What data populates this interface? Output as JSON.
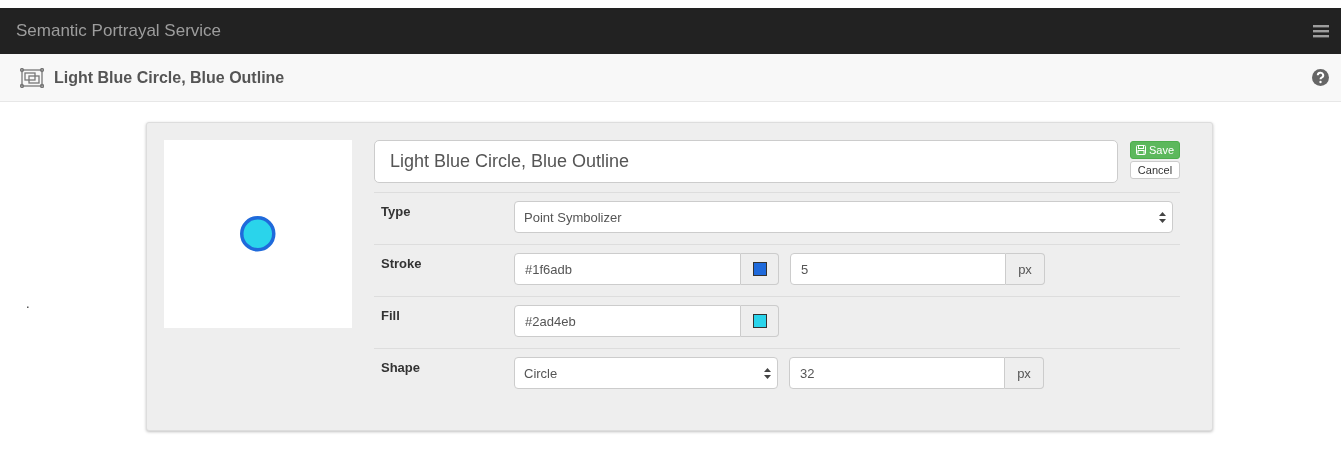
{
  "navbar": {
    "title": "Semantic Portrayal Service"
  },
  "header": {
    "title": "Light Blue Circle, Blue Outline"
  },
  "stray_mark": ".",
  "editor": {
    "name_value": "Light Blue Circle, Blue Outline",
    "buttons": [
      {
        "kind": "save",
        "label": "Save"
      },
      {
        "kind": "cancel",
        "label": "Cancel"
      }
    ],
    "rows": [
      {
        "label": "Type",
        "controls": [
          {
            "kind": "select",
            "value": "Point Symbolizer",
            "wide": true
          }
        ]
      },
      {
        "label": "Stroke",
        "controls": [
          {
            "kind": "color",
            "value": "#1f6adb",
            "color": "#1f6adb"
          },
          {
            "kind": "size",
            "value": "5",
            "unit": "px"
          }
        ]
      },
      {
        "label": "Fill",
        "controls": [
          {
            "kind": "color",
            "value": "#2ad4eb",
            "color": "#2ad4eb"
          }
        ]
      },
      {
        "label": "Shape",
        "controls": [
          {
            "kind": "select",
            "value": "Circle",
            "wide": false
          },
          {
            "kind": "size",
            "value": "32",
            "unit": "px"
          }
        ]
      }
    ]
  }
}
